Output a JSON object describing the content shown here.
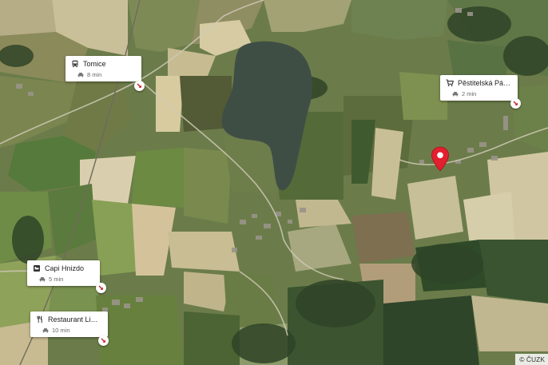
{
  "map": {
    "attribution": "© ČUZK",
    "colors": {
      "field_green": "#6b7c4a",
      "lake": "#3f4e45",
      "marker": "#e2202f"
    }
  },
  "pois": [
    {
      "name": "Tomice",
      "icon": "bus-icon",
      "travel_time": "8 min",
      "travel_mode_icon": "car-icon"
    },
    {
      "name": "Pěstitelská Pálen…",
      "icon": "cart-icon",
      "travel_time": "2 min",
      "travel_mode_icon": "car-icon"
    },
    {
      "name": "Capi Hnizdo",
      "icon": "hotel-icon",
      "travel_time": "5 min",
      "travel_mode_icon": "car-icon"
    },
    {
      "name": "Restaurant Lihovar",
      "icon": "restaurant-icon",
      "travel_time": "10 min",
      "travel_mode_icon": "car-icon"
    }
  ],
  "marker": {
    "icon": "location-pin-icon",
    "color": "#e2202f"
  }
}
